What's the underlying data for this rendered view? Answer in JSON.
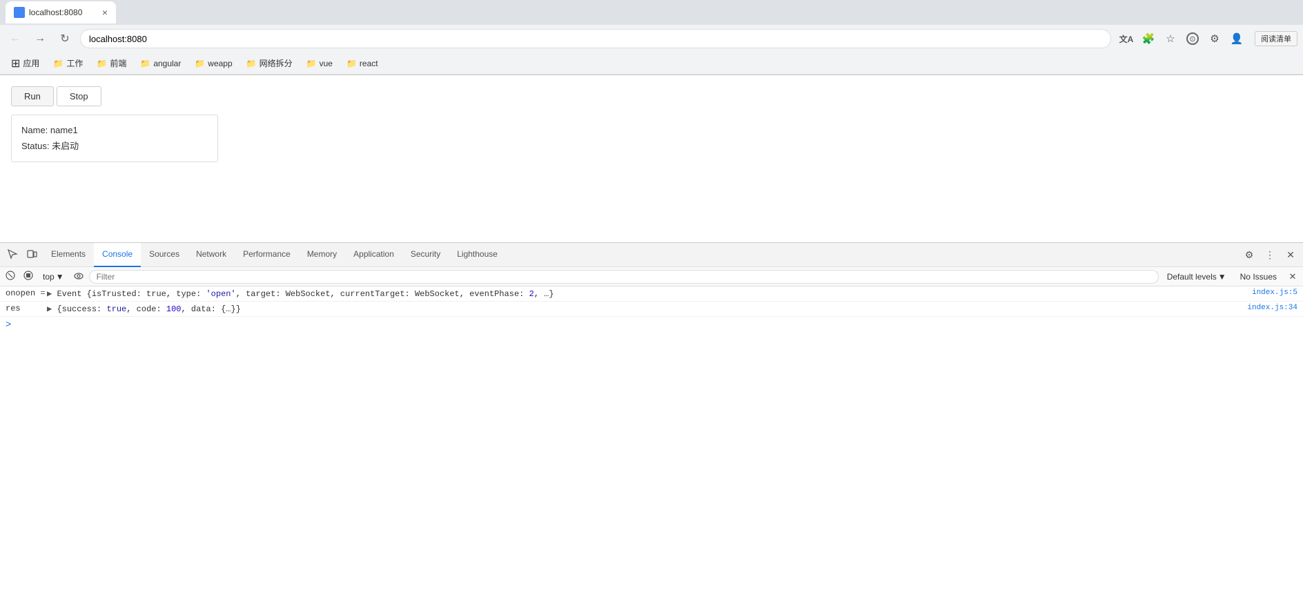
{
  "browser": {
    "tab": {
      "title": "localhost:8080",
      "favicon_color": "#4285f4"
    },
    "address": "localhost:8080",
    "nav": {
      "back_label": "←",
      "forward_label": "→",
      "reload_label": "↻"
    },
    "bookmarks": [
      {
        "id": "apps",
        "icon": "⊞",
        "label": "应用"
      },
      {
        "id": "work",
        "icon": "📁",
        "label": "工作"
      },
      {
        "id": "frontend",
        "icon": "📁",
        "label": "前端"
      },
      {
        "id": "angular",
        "icon": "📁",
        "label": "angular"
      },
      {
        "id": "weapp",
        "icon": "📁",
        "label": "weapp"
      },
      {
        "id": "network",
        "icon": "📁",
        "label": "网络拆分"
      },
      {
        "id": "vue",
        "icon": "📁",
        "label": "vue"
      },
      {
        "id": "react",
        "icon": "📁",
        "label": "react"
      }
    ],
    "toolbar_right": {
      "translate_icon": "T",
      "extensions_icon": "🧩",
      "star_icon": "☆",
      "circle_icon": "⊙",
      "settings_icon": "⚙",
      "profile_icon": "👤",
      "reader_label": "阅读清单"
    }
  },
  "page": {
    "buttons": {
      "run_label": "Run",
      "stop_label": "Stop"
    },
    "info_card": {
      "name_label": "Name:",
      "name_value": "name1",
      "status_label": "Status:",
      "status_value": "未启动"
    }
  },
  "devtools": {
    "tabs": [
      {
        "id": "elements",
        "label": "Elements",
        "active": false
      },
      {
        "id": "console",
        "label": "Console",
        "active": true
      },
      {
        "id": "sources",
        "label": "Sources",
        "active": false
      },
      {
        "id": "network",
        "label": "Network",
        "active": false
      },
      {
        "id": "performance",
        "label": "Performance",
        "active": false
      },
      {
        "id": "memory",
        "label": "Memory",
        "active": false
      },
      {
        "id": "application",
        "label": "Application",
        "active": false
      },
      {
        "id": "security",
        "label": "Security",
        "active": false
      },
      {
        "id": "lighthouse",
        "label": "Lighthouse",
        "active": false
      }
    ],
    "console": {
      "context": "top",
      "filter_placeholder": "Filter",
      "default_levels_label": "Default levels",
      "no_issues_label": "No Issues",
      "lines": [
        {
          "id": "line1",
          "prefix": "onopen",
          "operator": "=",
          "content": "▶ Event {isTrusted: true, type: 'open', target: WebSocket, currentTarget: WebSocket, eventPhase: 2, …}",
          "link": "index.js:5"
        },
        {
          "id": "line2",
          "prefix": "res",
          "operator": "▶",
          "content": "{success: true, code: 100, data: {…}}",
          "link": "index.js:34"
        }
      ]
    }
  }
}
